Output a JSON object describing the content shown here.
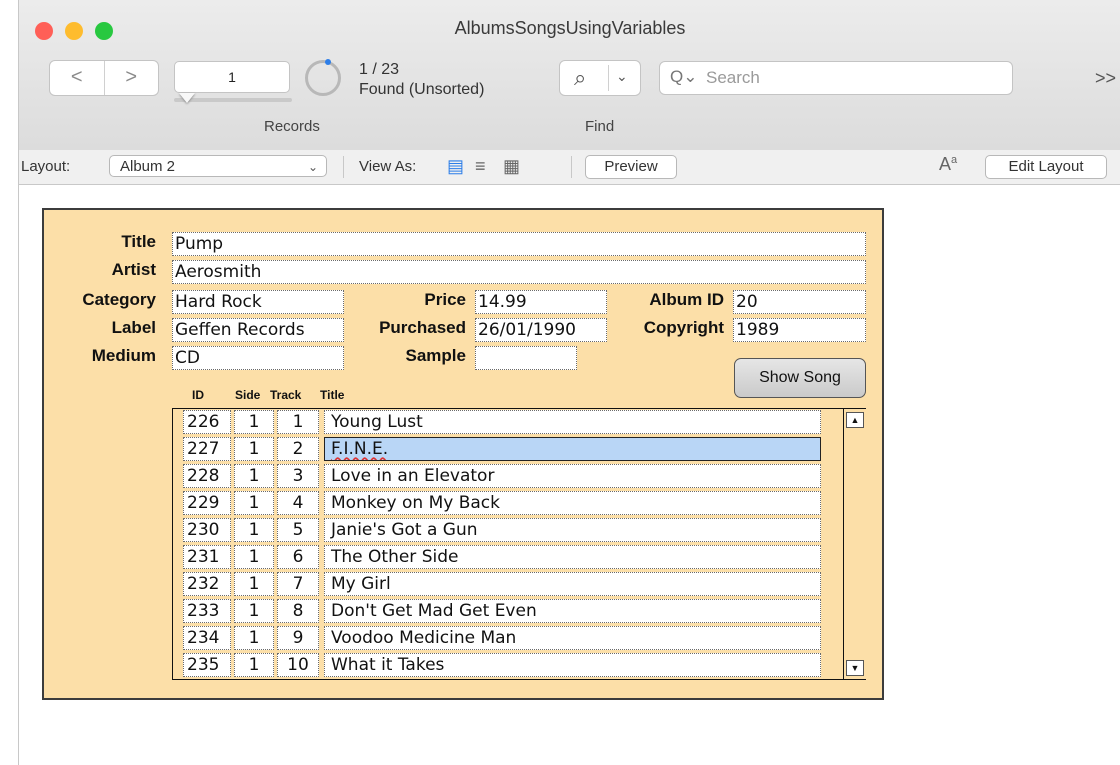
{
  "window": {
    "title": "AlbumsSongsUsingVariables",
    "traffic_lights": [
      "#ff5f57",
      "#febc2e",
      "#28c840"
    ]
  },
  "toolbar": {
    "prev_icon": "<",
    "next_icon": ">",
    "record_number": "1",
    "record_count": "1 / 23",
    "found_status": "Found (Unsorted)",
    "records_label": "Records",
    "find_label": "Find",
    "search_placeholder": "Search",
    "more_icon": ">>"
  },
  "layout_bar": {
    "layout_label": "Layout:",
    "layout_value": "Album 2",
    "view_as_label": "View As:",
    "preview_label": "Preview",
    "edit_layout_label": "Edit Layout"
  },
  "record": {
    "labels": {
      "title": "Title",
      "artist": "Artist",
      "category": "Category",
      "label": "Label",
      "medium": "Medium",
      "price": "Price",
      "purchased": "Purchased",
      "sample": "Sample",
      "album_id": "Album ID",
      "copyright": "Copyright"
    },
    "values": {
      "title": "Pump",
      "artist": "Aerosmith",
      "category": "Hard Rock",
      "label": "Geffen Records",
      "medium": "CD",
      "price": "14.99",
      "purchased": "26/01/1990",
      "sample": "",
      "album_id": "20",
      "copyright": "1989"
    },
    "show_song_label": "Show Song"
  },
  "songs": {
    "headers": {
      "id": "ID",
      "side": "Side",
      "track": "Track",
      "title": "Title"
    },
    "rows": [
      {
        "id": "226",
        "side": "1",
        "track": "1",
        "title": "Young Lust"
      },
      {
        "id": "227",
        "side": "1",
        "track": "2",
        "title": "F.I.N.E."
      },
      {
        "id": "228",
        "side": "1",
        "track": "3",
        "title": "Love in an Elevator"
      },
      {
        "id": "229",
        "side": "1",
        "track": "4",
        "title": "Monkey on My Back"
      },
      {
        "id": "230",
        "side": "1",
        "track": "5",
        "title": "Janie's Got a Gun"
      },
      {
        "id": "231",
        "side": "1",
        "track": "6",
        "title": "The Other Side"
      },
      {
        "id": "232",
        "side": "1",
        "track": "7",
        "title": "My Girl"
      },
      {
        "id": "233",
        "side": "1",
        "track": "8",
        "title": "Don't Get Mad Get Even"
      },
      {
        "id": "234",
        "side": "1",
        "track": "9",
        "title": "Voodoo Medicine Man"
      },
      {
        "id": "235",
        "side": "1",
        "track": "10",
        "title": "What it Takes"
      }
    ]
  }
}
